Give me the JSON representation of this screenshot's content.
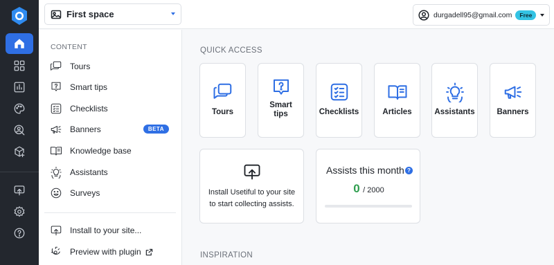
{
  "topbar": {
    "space_name": "First space",
    "user_email": "durgadell95@gmail.com",
    "plan_badge": "Free"
  },
  "rail": {
    "items": [
      "home-icon",
      "grid-icon",
      "analytics-icon",
      "palette-icon",
      "user-search-icon",
      "cube-plus-icon",
      "install-icon",
      "settings-icon",
      "help-icon"
    ],
    "active": "home-icon"
  },
  "sidebar": {
    "heading": "CONTENT",
    "items": [
      {
        "label": "Tours",
        "icon": "tours-icon"
      },
      {
        "label": "Smart tips",
        "icon": "smart-tips-icon"
      },
      {
        "label": "Checklists",
        "icon": "checklists-icon"
      },
      {
        "label": "Banners",
        "icon": "banners-icon",
        "badge": "BETA"
      },
      {
        "label": "Knowledge base",
        "icon": "knowledge-base-icon"
      },
      {
        "label": "Assistants",
        "icon": "assistants-icon"
      },
      {
        "label": "Surveys",
        "icon": "surveys-icon"
      }
    ],
    "bottom": [
      {
        "label": "Install to your site...",
        "icon": "install-icon"
      },
      {
        "label": "Preview with plugin",
        "icon": "preview-icon"
      }
    ]
  },
  "main": {
    "quick_access_title": "QUICK ACCESS",
    "quick_access": [
      {
        "label": "Tours",
        "icon": "tours-icon"
      },
      {
        "label": "Smart tips",
        "icon": "smart-tips-icon"
      },
      {
        "label": "Checklists",
        "icon": "checklists-icon"
      },
      {
        "label": "Articles",
        "icon": "articles-icon"
      },
      {
        "label": "Assistants",
        "icon": "assistants-icon"
      },
      {
        "label": "Banners",
        "icon": "banners-icon"
      }
    ],
    "install_card": {
      "text": "Install Usetiful to your site to start collecting assists."
    },
    "assists_card": {
      "title": "Assists this month",
      "help": "?",
      "used": "0",
      "total": "/ 2000",
      "progress_fraction": 0
    },
    "inspiration_title": "INSPIRATION"
  },
  "colors": {
    "accent": "#2f6fe4",
    "rail_bg": "#23272e",
    "success": "#2f9e4f",
    "plan_badge": "#34c3e4"
  }
}
